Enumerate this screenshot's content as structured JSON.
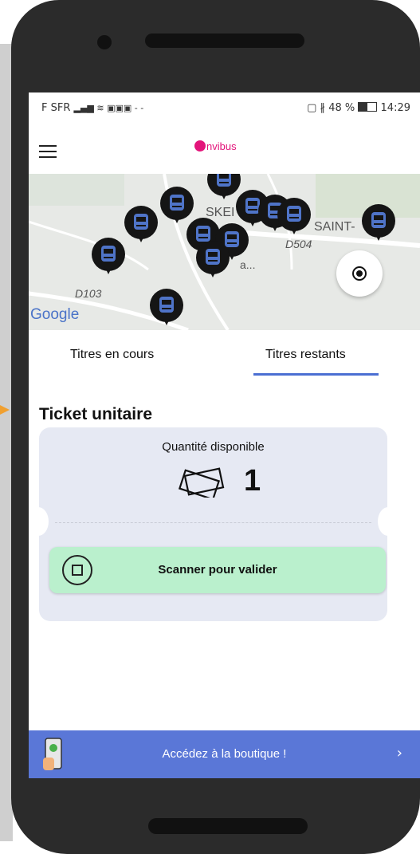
{
  "status_bar": {
    "carrier": "F SFR",
    "battery": "48 %",
    "time": "14:29"
  },
  "app": {
    "logo_text": "nvibus"
  },
  "map": {
    "labels": [
      "SKEI",
      "SAINT-",
      "D504",
      "D103",
      "a..."
    ],
    "attribution": "Google"
  },
  "tabs": [
    {
      "label": "Titres en cours",
      "active": false
    },
    {
      "label": "Titres restants",
      "active": true
    }
  ],
  "ticket": {
    "title": "Ticket unitaire",
    "quantity_label": "Quantité disponible",
    "quantity": "1",
    "scan_label": "Scanner pour valider"
  },
  "shop": {
    "label": "Accédez à la boutique !",
    "chevron": "›"
  },
  "colors": {
    "accent": "#4b6fd2",
    "brand": "#e3147a",
    "scan_button": "#baf0cd",
    "shop_bar": "#5a77d7",
    "ticket_bg": "#e6e9f3"
  }
}
